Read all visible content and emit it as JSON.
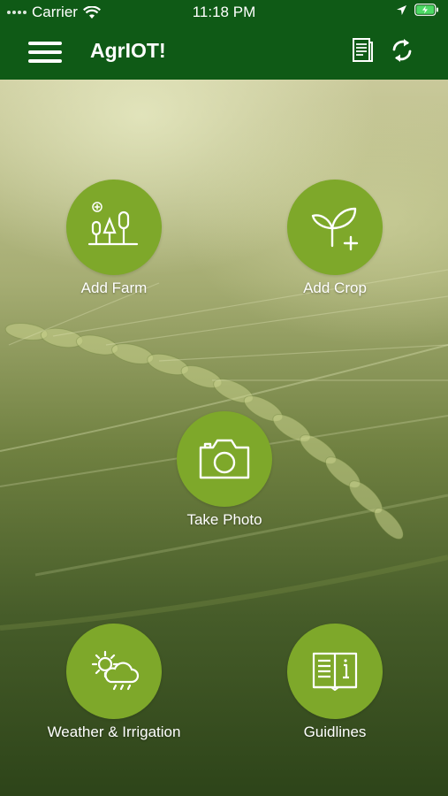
{
  "status_bar": {
    "carrier": "Carrier",
    "time": "11:18 PM"
  },
  "header": {
    "title": "AgrIOT!"
  },
  "actions": [
    {
      "label": "Add Farm",
      "icon": "farm-trees-icon"
    },
    {
      "label": "Add Crop",
      "icon": "sprout-plus-icon"
    },
    {
      "label": "Take Photo",
      "icon": "camera-icon"
    },
    {
      "label": "Weather & Irrigation",
      "icon": "weather-icon"
    },
    {
      "label": "Guidlines",
      "icon": "book-icon"
    }
  ],
  "colors": {
    "header": "#0f5a16",
    "button": "#7ea82a",
    "text": "#ffffff"
  }
}
